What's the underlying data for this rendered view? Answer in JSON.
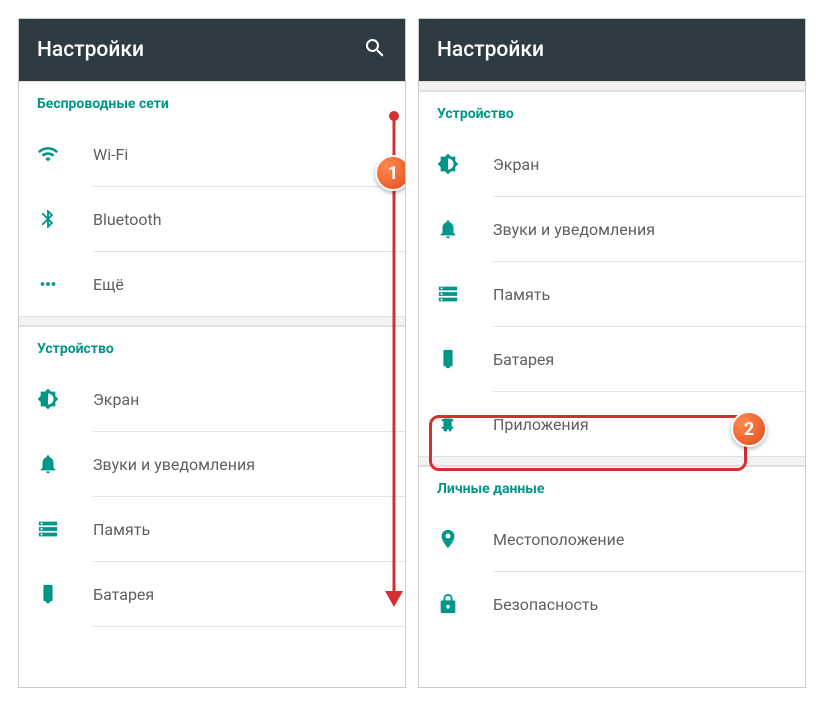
{
  "left": {
    "title": "Настройки",
    "sections": [
      {
        "header": "Беспроводные сети",
        "items": [
          {
            "icon": "wifi",
            "label": "Wi-Fi"
          },
          {
            "icon": "bluetooth",
            "label": "Bluetooth"
          },
          {
            "icon": "more",
            "label": "Ещё"
          }
        ]
      },
      {
        "header": "Устройство",
        "items": [
          {
            "icon": "brightness",
            "label": "Экран"
          },
          {
            "icon": "bell",
            "label": "Звуки и уведомления"
          },
          {
            "icon": "storage",
            "label": "Память"
          },
          {
            "icon": "battery",
            "label": "Батарея"
          }
        ]
      }
    ]
  },
  "right": {
    "title": "Настройки",
    "sections": [
      {
        "header": "Устройство",
        "items": [
          {
            "icon": "brightness",
            "label": "Экран"
          },
          {
            "icon": "bell",
            "label": "Звуки и уведомления"
          },
          {
            "icon": "storage",
            "label": "Память"
          },
          {
            "icon": "battery",
            "label": "Батарея"
          },
          {
            "icon": "apps",
            "label": "Приложения"
          }
        ]
      },
      {
        "header": "Личные данные",
        "items": [
          {
            "icon": "location",
            "label": "Местоположение"
          },
          {
            "icon": "security",
            "label": "Безопасность"
          }
        ]
      }
    ]
  },
  "badges": {
    "one": "1",
    "two": "2"
  }
}
